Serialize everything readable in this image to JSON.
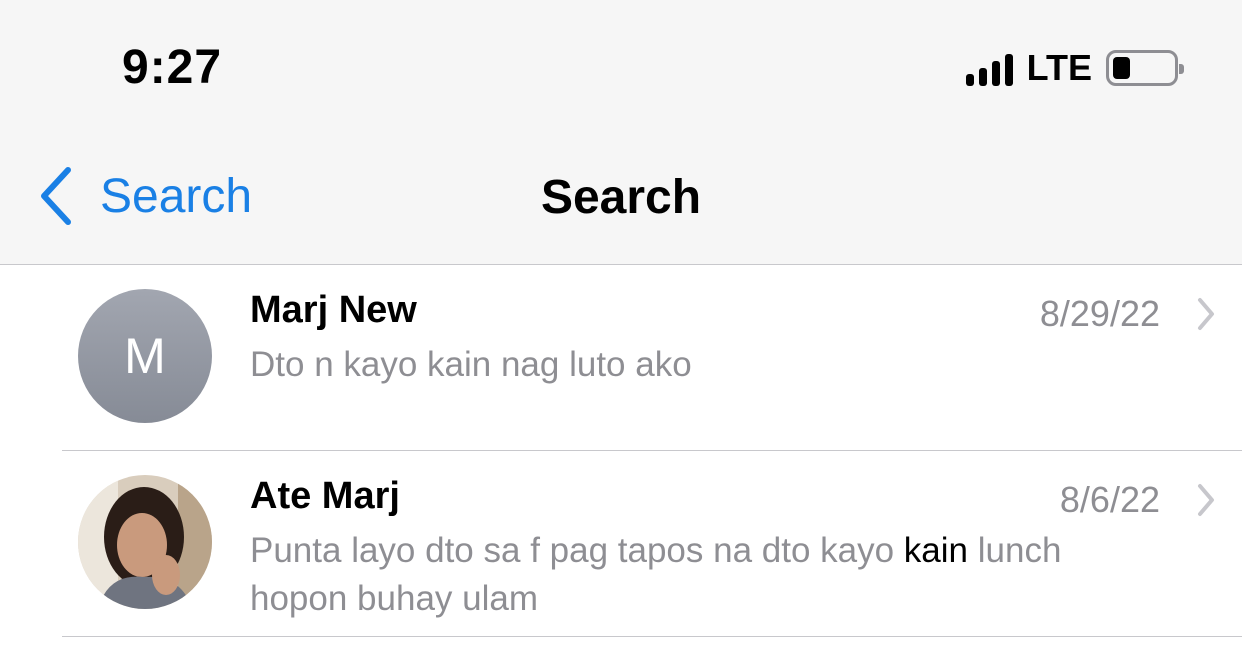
{
  "status_bar": {
    "time": "9:27",
    "network": "LTE",
    "signal_icon": "signal-bars-icon",
    "battery_icon": "battery-icon",
    "battery_level": 0.3
  },
  "nav": {
    "back_label": "Search",
    "title": "Search",
    "back_icon": "chevron-left-icon"
  },
  "results": [
    {
      "name": "Marj New",
      "initial": "M",
      "date": "8/29/22",
      "preview": "Dto n kayo kain nag luto ako"
    },
    {
      "name": "Ate Marj",
      "date": "8/6/22",
      "preview_before": "Punta layo dto sa f pag tapos na dto kayo ",
      "preview_match": "kain",
      "preview_after": " lunch hopon buhay ulam"
    }
  ],
  "colors": {
    "accent": "#1a80e5",
    "secondary_text": "#8e8e93",
    "bar_background": "#f6f6f6"
  }
}
